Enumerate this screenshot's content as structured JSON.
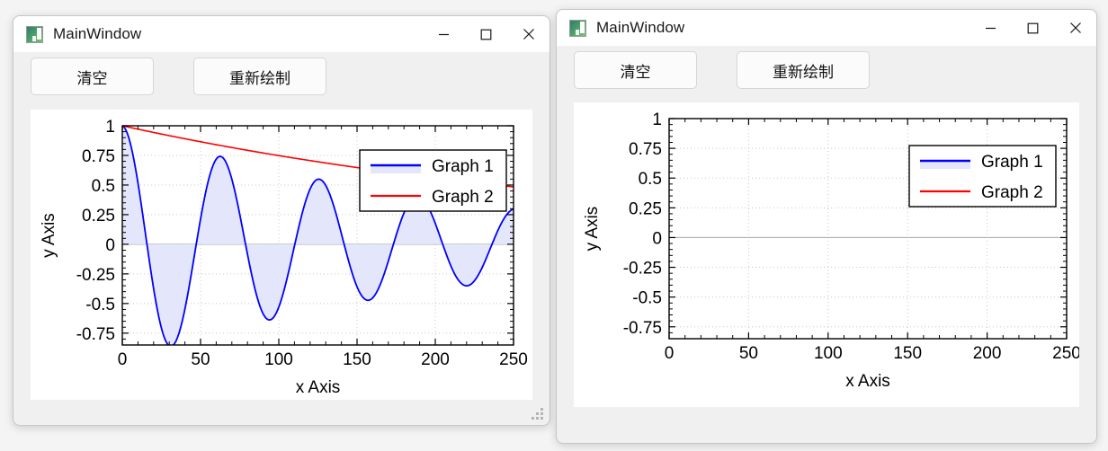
{
  "windows": [
    {
      "id": "left",
      "title": "MainWindow",
      "icon": "app-icon",
      "controls": {
        "minimize": "minimize-icon",
        "maximize": "maximize-icon",
        "close": "close-icon"
      },
      "toolbar": {
        "clear_label": "清空",
        "redraw_label": "重新绘制"
      },
      "has_data": true
    },
    {
      "id": "right",
      "title": "MainWindow",
      "icon": "app-icon",
      "controls": {
        "minimize": "minimize-icon",
        "maximize": "maximize-icon",
        "close": "close-icon"
      },
      "toolbar": {
        "clear_label": "清空",
        "redraw_label": "重新绘制"
      },
      "has_data": false
    }
  ],
  "colors": {
    "graph1_line": "#0000ff",
    "graph1_fill": "#e4e7fb",
    "graph2_line": "#ff0000",
    "axis": "#000000",
    "grid": "#c8c8c8",
    "zero_line": "#b0b0b0",
    "panel_bg": "#ffffff",
    "window_bg": "#f0f0f0",
    "titlebar_bg": "#ffffff"
  },
  "chart_data": [
    {
      "id": "left-plot",
      "type": "line",
      "title": "",
      "xlabel": "x Axis",
      "ylabel": "y Axis",
      "xlim": [
        0,
        250
      ],
      "ylim": [
        -0.85,
        1.0
      ],
      "xticks": [
        0,
        50,
        100,
        150,
        200,
        250
      ],
      "xticklabels": [
        "0",
        "50",
        "100",
        "150",
        "200",
        "250"
      ],
      "yticks": [
        1,
        0.75,
        0.5,
        0.25,
        0,
        -0.25,
        -0.5,
        -0.75
      ],
      "yticklabels": [
        "1",
        "0.75",
        "0.5",
        "0.25",
        "0",
        "-0.25",
        "-0.5",
        "-0.75"
      ],
      "grid": true,
      "legend_position": "upper right",
      "legend": [
        "Graph 1",
        "Graph 2"
      ],
      "series": [
        {
          "name": "Graph 1",
          "kind": "damped-cosine-filled",
          "color": "#0000ff",
          "fill": "#e4e7fb",
          "amplitude": 1.0,
          "decay_constant": 210,
          "period": 63,
          "values_at_peaks": [
            {
              "x": 0,
              "y": 1.0
            },
            {
              "x": 32,
              "y": -0.84
            },
            {
              "x": 64,
              "y": 0.65
            },
            {
              "x": 95,
              "y": -0.54
            },
            {
              "x": 127,
              "y": 0.42
            },
            {
              "x": 158,
              "y": -0.36
            },
            {
              "x": 190,
              "y": 0.27
            },
            {
              "x": 221,
              "y": -0.23
            },
            {
              "x": 250,
              "y": 0.17
            }
          ]
        },
        {
          "name": "Graph 2",
          "kind": "exponential-envelope",
          "color": "#ff0000",
          "amplitude": 1.0,
          "decay_constant": 345,
          "values": [
            {
              "x": 0,
              "y": 1.0
            },
            {
              "x": 50,
              "y": 0.865
            },
            {
              "x": 100,
              "y": 0.748
            },
            {
              "x": 150,
              "y": 0.648
            },
            {
              "x": 200,
              "y": 0.561
            },
            {
              "x": 250,
              "y": 0.485
            }
          ]
        }
      ]
    },
    {
      "id": "right-plot",
      "type": "line",
      "title": "",
      "xlabel": "x Axis",
      "ylabel": "y Axis",
      "xlim": [
        0,
        250
      ],
      "ylim": [
        -0.85,
        1.0
      ],
      "xticks": [
        0,
        50,
        100,
        150,
        200,
        250
      ],
      "xticklabels": [
        "0",
        "50",
        "100",
        "150",
        "200",
        "250"
      ],
      "yticks": [
        1,
        0.75,
        0.5,
        0.25,
        0,
        -0.25,
        -0.5,
        -0.75
      ],
      "yticklabels": [
        "1",
        "0.75",
        "0.5",
        "0.25",
        "0",
        "-0.25",
        "-0.5",
        "-0.75"
      ],
      "grid": true,
      "legend_position": "upper right",
      "legend": [
        "Graph 1",
        "Graph 2"
      ],
      "series": [
        {
          "name": "Graph 1",
          "kind": "empty",
          "color": "#0000ff",
          "fill": "#e4e7fb",
          "values": []
        },
        {
          "name": "Graph 2",
          "kind": "empty",
          "color": "#ff0000",
          "values": []
        }
      ]
    }
  ]
}
